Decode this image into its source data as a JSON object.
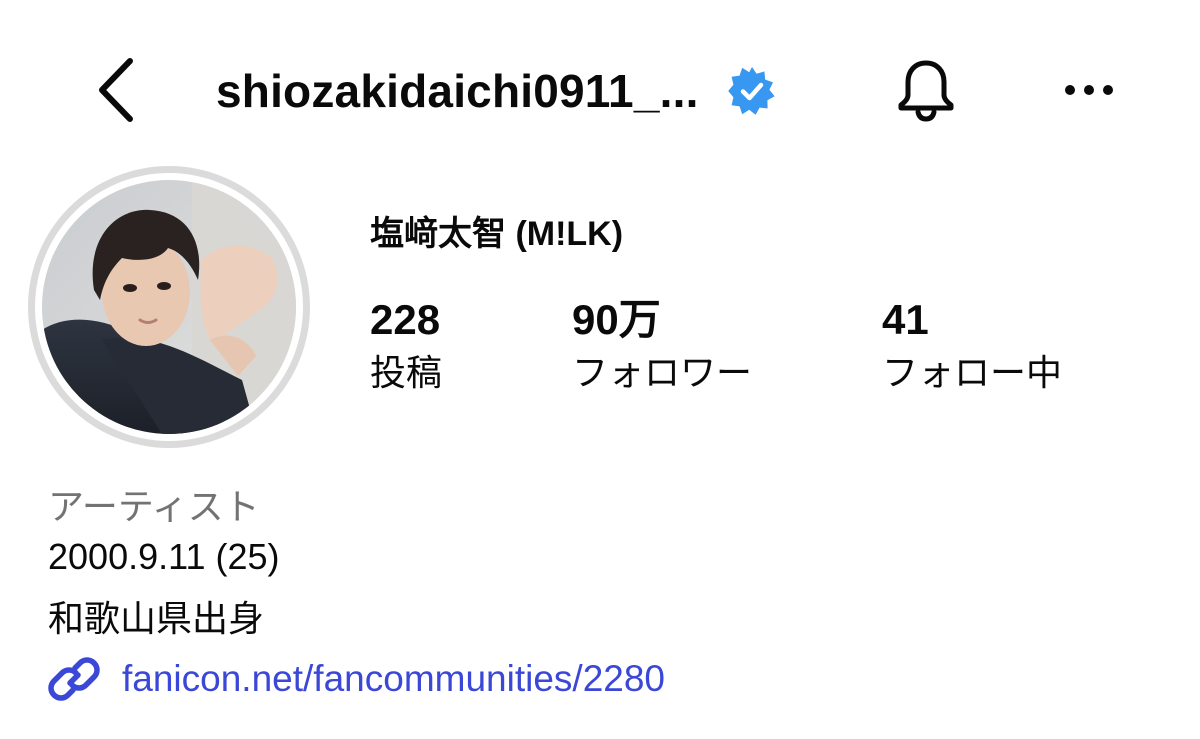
{
  "header": {
    "username": "shiozakidaichi0911_...",
    "verified": true,
    "icons": {
      "back": "chevron-left-icon",
      "verified": "verified-badge-icon",
      "notifications": "bell-icon",
      "more": "more-horizontal-icon"
    }
  },
  "profile": {
    "display_name": "塩﨑太智 (M!LK)",
    "avatar": "profile-photo"
  },
  "stats": {
    "posts": {
      "value": "228",
      "label": "投稿"
    },
    "followers": {
      "value": "90万",
      "label": "フォロワー"
    },
    "following": {
      "value": "41",
      "label": "フォロー中"
    }
  },
  "bio": {
    "category": "アーティスト",
    "lines": [
      "2000.9.11 (25)",
      "和歌山県出身"
    ],
    "link": "fanicon.net/fancommunities/2280",
    "link_icon": "link-icon"
  },
  "colors": {
    "verified": "#3897f0",
    "link": "#3b47d6",
    "category": "#737373",
    "avatar_ring": "#dbdbdb"
  }
}
